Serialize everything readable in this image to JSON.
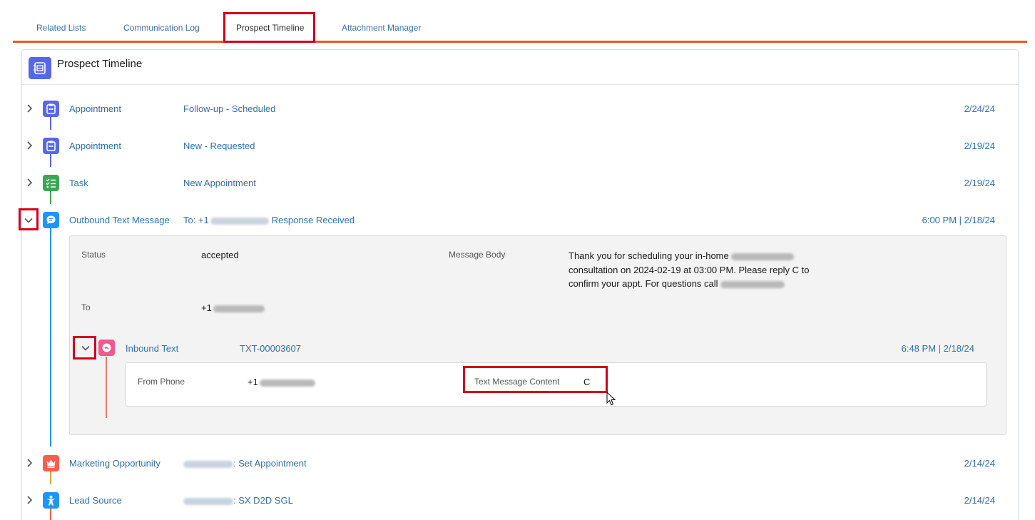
{
  "tabs": [
    {
      "label": "Related Lists",
      "active": false
    },
    {
      "label": "Communication Log",
      "active": false
    },
    {
      "label": "Prospect Timeline",
      "active": true
    },
    {
      "label": "Attachment Manager",
      "active": false
    }
  ],
  "card": {
    "title": "Prospect Timeline",
    "icon": "timeline-icon"
  },
  "timeline": {
    "items": [
      {
        "type": "Appointment",
        "subject": "Follow-up - Scheduled",
        "date": "2/24/24",
        "icon": "calendar-icon",
        "color": "#5867e8"
      },
      {
        "type": "Appointment",
        "subject": "New - Requested",
        "date": "2/19/24",
        "icon": "calendar-icon",
        "color": "#5867e8"
      },
      {
        "type": "Task",
        "subject": "New Appointment",
        "date": "2/19/24",
        "icon": "task-list-icon",
        "color": "#3ba755"
      },
      {
        "type": "Outbound Text Message",
        "subject_prefix": "To: +1",
        "subject_suffix": "Response Received",
        "date": "6:00 PM | 2/18/24",
        "icon": "chat-bubble-icon",
        "color": "#1b96ff",
        "expanded": true
      },
      {
        "type": "Marketing Opportunity",
        "subject_suffix": ": Set Appointment",
        "date": "2/14/24",
        "icon": "crown-icon",
        "color": "#fe5c4c"
      },
      {
        "type": "Lead Source",
        "subject_suffix": ": SX D2D SGL",
        "date": "2/14/24",
        "icon": "person-icon",
        "color": "#1b96ff"
      }
    ],
    "expanded_detail": {
      "status_label": "Status",
      "status_value": "accepted",
      "to_label": "To",
      "to_value_prefix": "+1",
      "message_label": "Message Body",
      "message_line1": "Thank you for scheduling your in-home",
      "message_line2": "consultation on 2024-02-19 at 03:00 PM. Please reply C to",
      "message_line3": "confirm your appt. For questions call",
      "inbound": {
        "type": "Inbound Text",
        "subject": "TXT-00003607",
        "date": "6:48 PM | 2/18/24",
        "icon": "reply-bubble-icon",
        "color": "#f0598c",
        "from_label": "From Phone",
        "from_value_prefix": "+1",
        "content_label": "Text Message Content",
        "content_value": "C"
      }
    }
  },
  "colors": {
    "accent_tab_border": "#e4572e",
    "highlight": "#d0021b",
    "link": "#2f6fb0"
  }
}
